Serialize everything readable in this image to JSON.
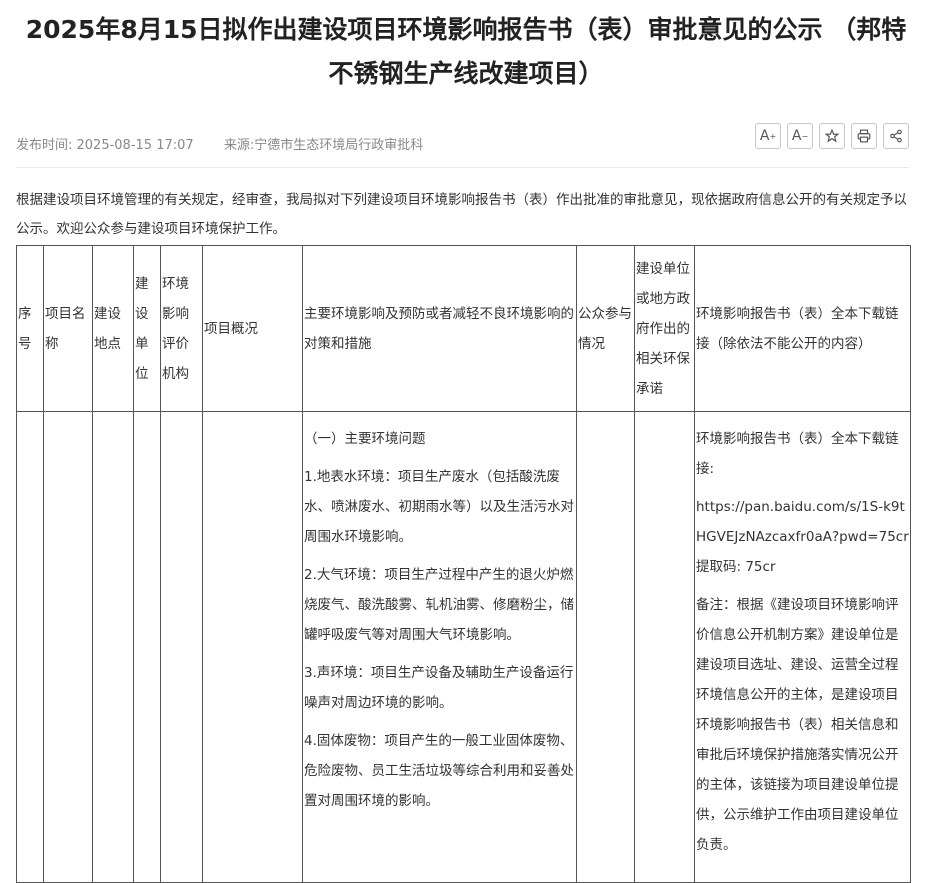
{
  "header": {
    "title": "2025年8月15日拟作出建设项目环境影响报告书（表）审批意见的公示 （邦特不锈钢生产线改建项目）",
    "publish_time": "发布时间: 2025-08-15 17:07",
    "source": "来源:宁德市生态环境局行政审批科"
  },
  "toolbar": {
    "font_increase": "A",
    "font_decrease": "A"
  },
  "intro": "根据建设项目环境管理的有关规定，经审查，我局拟对下列建设项目环境影响报告书（表）作出批准的审批意见，现依据政府信息公开的有关规定予以公示。欢迎公众参与建设项目环境保护工作。",
  "table": {
    "headers": [
      "序号",
      "项目名称",
      "建设地点",
      "建设单位",
      "环境影响评价机构",
      "项目概况",
      "主要环境影响及预防或者减轻不良环境影响的对策和措施",
      "公众参与情况",
      "建设单位或地方政府作出的相关环保承诺",
      "环境影响报告书（表）全本下载链接（除依法不能公开的内容）"
    ],
    "impacts": [
      "（一）主要环境问题",
      "1.地表水环境：项目生产废水（包括酸洗废水、喷淋废水、初期雨水等）以及生活污水对周围水环境影响。",
      "2.大气环境：项目生产过程中产生的退火炉燃烧废气、酸洗酸雾、轧机油雾、修磨粉尘，储罐呼吸废气等对周围大气环境影响。",
      "3.声环境：项目生产设备及辅助生产设备运行噪声对周边环境的影响。",
      "4.固体废物：项目产生的一般工业固体废物、危险废物、员工生活垃圾等综合利用和妥善处置对周围环境的影响。"
    ],
    "download": [
      "环境影响报告书（表）全本下载链接:",
      "https://pan.baidu.com/s/1S-k9tHGVEJzNAzcaxfr0aA?pwd=75cr 提取码: 75cr",
      "备注：根据《建设项目环境影响评价信息公开机制方案》建设单位是建设项目选址、建设、运营全过程环境信息公开的主体，是建设项目环境影响报告书（表）相关信息和审批后环境保护措施落实情况公开的主体，该链接为项目建设单位提供，公示维护工作由项目建设单位负责。"
    ]
  }
}
